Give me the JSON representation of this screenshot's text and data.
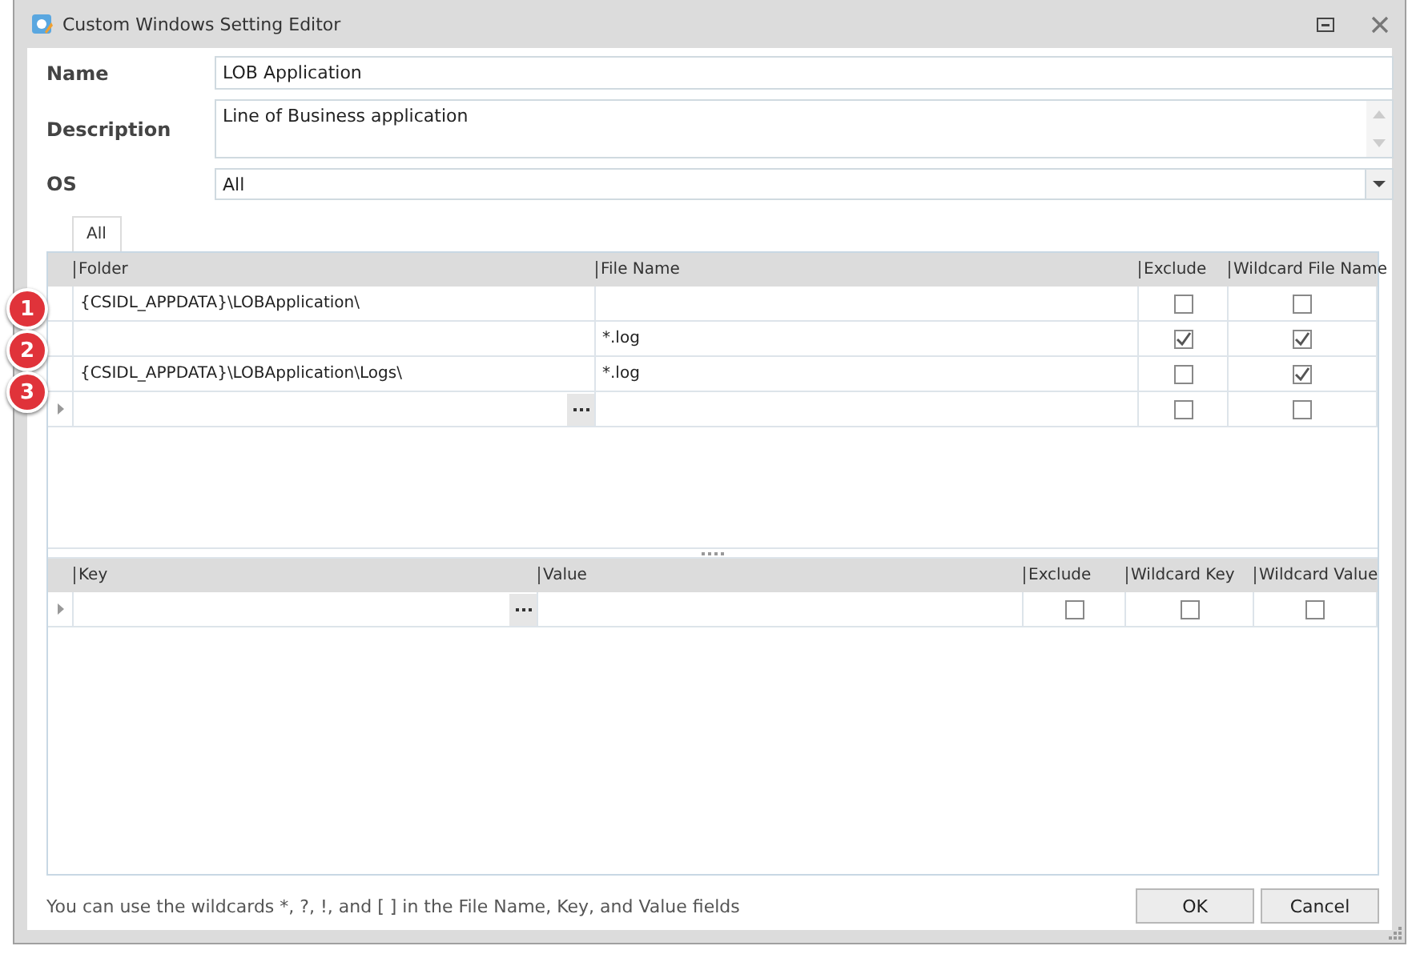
{
  "window": {
    "title": "Custom Windows Setting Editor"
  },
  "fields": [
    {
      "label": "Name",
      "value": "LOB Application",
      "kind": "text"
    },
    {
      "label": "Description",
      "value": "Line of Business application",
      "kind": "memo"
    },
    {
      "label": "OS",
      "value": "All",
      "kind": "dropdown"
    }
  ],
  "tabs": [
    {
      "label": "All",
      "selected": true
    }
  ],
  "files_grid": {
    "columns": [
      "Folder",
      "File Name",
      "Exclude",
      "Wildcard File Name"
    ],
    "rows": [
      {
        "badge": "1",
        "folder": "{CSIDL_APPDATA}\\LOBApplication\\",
        "file_name": "",
        "exclude": false,
        "wildcard": false
      },
      {
        "badge": "2",
        "folder": "",
        "file_name": "*.log",
        "exclude": true,
        "wildcard": true
      },
      {
        "badge": "3",
        "folder": "{CSIDL_APPDATA}\\LOBApplication\\Logs\\",
        "file_name": "*.log",
        "exclude": false,
        "wildcard": true
      }
    ],
    "new_row": {
      "exclude": false,
      "wildcard": false
    }
  },
  "registry_grid": {
    "columns": [
      "Key",
      "Value",
      "Exclude",
      "Wildcard Key",
      "Wildcard Value"
    ],
    "new_row": {
      "exclude": false,
      "wildcard_key": false,
      "wildcard_value": false
    }
  },
  "hint": "You can use the wildcards *, ?, !, and [ ] in the File Name, Key, and Value fields",
  "buttons": [
    "OK",
    "Cancel"
  ]
}
